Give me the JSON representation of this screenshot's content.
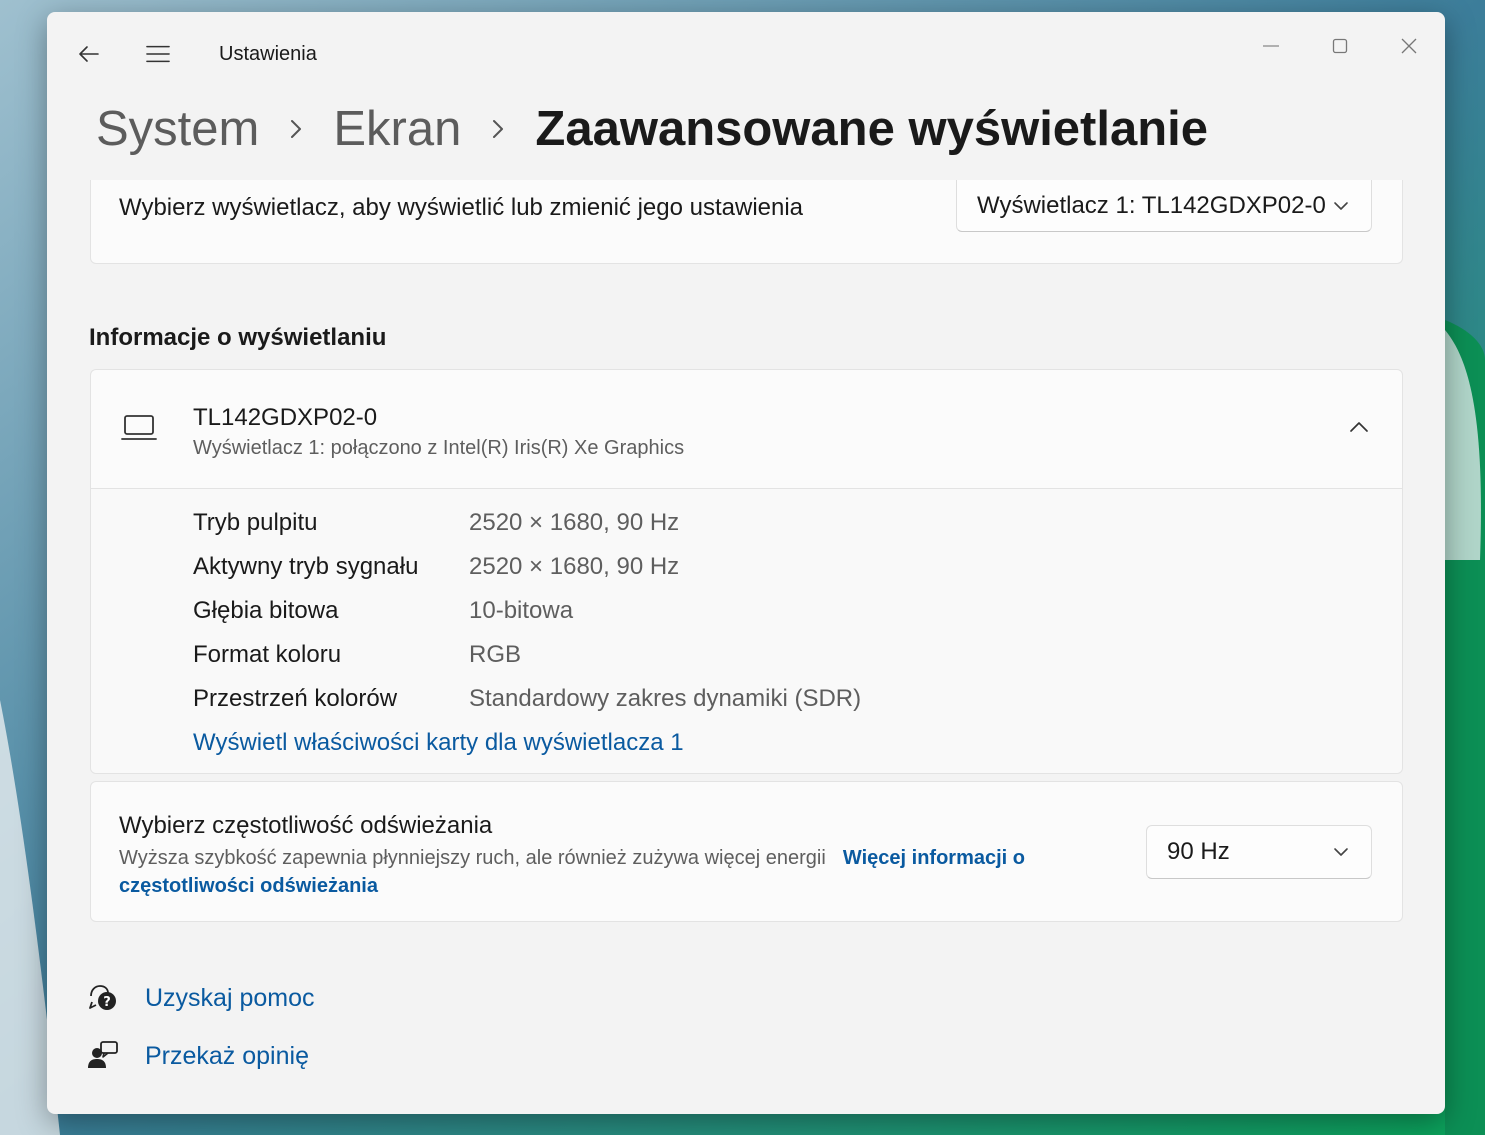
{
  "window": {
    "app_title": "Ustawienia"
  },
  "breadcrumb": {
    "items": [
      "System",
      "Ekran"
    ],
    "current": "Zaawansowane wyświetlanie"
  },
  "select_display": {
    "label": "Wybierz wyświetlacz, aby wyświetlić lub zmienić jego ustawienia",
    "selected": "Wyświetlacz 1: TL142GDXP02-0"
  },
  "display_info": {
    "section_title": "Informacje o wyświetlaniu",
    "monitor_name": "TL142GDXP02-0",
    "monitor_sub": "Wyświetlacz 1: połączono z Intel(R) Iris(R) Xe Graphics",
    "rows": [
      {
        "label": "Tryb pulpitu",
        "value": "2520 × 1680, 90 Hz"
      },
      {
        "label": "Aktywny tryb sygnału",
        "value": "2520 × 1680, 90 Hz"
      },
      {
        "label": "Głębia bitowa",
        "value": "10-bitowa"
      },
      {
        "label": "Format koloru",
        "value": "RGB"
      },
      {
        "label": "Przestrzeń kolorów",
        "value": "Standardowy zakres dynamiki (SDR)"
      }
    ],
    "adapter_link": "Wyświetl właściwości karty dla wyświetlacza 1"
  },
  "refresh_rate": {
    "title": "Wybierz częstotliwość odświeżania",
    "description": "Wyższa szybkość zapewnia płynniejszy ruch, ale również zużywa więcej energii",
    "link_part1": "Więcej informacji o",
    "link_part2": "częstotliwości odświeżania",
    "selected": "90 Hz"
  },
  "help": {
    "get_help": "Uzyskaj pomoc",
    "feedback": "Przekaż opinię"
  },
  "colors": {
    "accent_link": "#0a5aa0",
    "window_bg": "#f3f3f3",
    "card_bg": "#fbfbfb"
  }
}
